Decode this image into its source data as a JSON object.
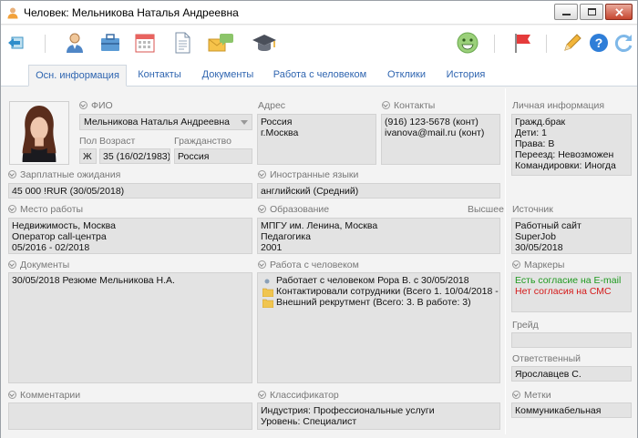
{
  "window": {
    "title": "Человек: Мельникова Наталья Андреевна"
  },
  "tabs": [
    {
      "label": "Осн. информация"
    },
    {
      "label": "Контакты"
    },
    {
      "label": "Документы"
    },
    {
      "label": "Работа с человеком"
    },
    {
      "label": "Отклики"
    },
    {
      "label": "История"
    }
  ],
  "toolbar": {
    "icons": [
      "back-icon",
      "person-icon",
      "briefcase-icon",
      "calendar-icon",
      "document-icon",
      "mail-chat-icon",
      "graduation-cap-icon",
      "smiley-icon",
      "flag-icon",
      "pencil-icon",
      "help-icon",
      "refresh-icon"
    ],
    "colors": {
      "smiley": "#9bd07a",
      "flag": "#e53b3b",
      "help": "#2f7ed8",
      "refresh": "#7fb8e8"
    }
  },
  "person": {
    "fio_label": "ФИО",
    "fio_value": "Мельникова Наталья Андреевна",
    "pol_label": "Пол",
    "pol_value": "Ж",
    "age_label": "Возраст",
    "age_value": "35 (16/02/1983)",
    "citizenship_label": "Гражданство",
    "citizenship_value": "Россия"
  },
  "address": {
    "label": "Адрес",
    "lines": [
      "Россия",
      "г.Москва"
    ]
  },
  "contacts": {
    "label": "Контакты",
    "lines": [
      "(916) 123-5678 (конт)",
      "ivanova@mail.ru (конт)"
    ]
  },
  "personal_info": {
    "label": "Личная информация",
    "lines": [
      "Гражд.брак",
      "Дети: 1",
      "Права: В",
      "Переезд: Невозможен",
      "Командировки: Иногда"
    ]
  },
  "salary": {
    "label": "Зарплатные ожидания",
    "value": "45 000 !RUR  (30/05/2018)"
  },
  "languages": {
    "label": "Иностранные языки",
    "value": "английский (Средний)"
  },
  "workplace": {
    "label": "Место работы",
    "lines": [
      "Недвижимость, Москва",
      "Оператор call-центра",
      "05/2016 - 02/2018"
    ]
  },
  "education": {
    "label": "Образование",
    "level": "Высшее",
    "lines": [
      "МПГУ им. Ленина, Москва",
      "Педагогика",
      "2001"
    ]
  },
  "source": {
    "label": "Источник",
    "lines": [
      "Работный сайт",
      "SuperJob",
      "30/05/2018"
    ]
  },
  "documents": {
    "label": "Документы",
    "value": "30/05/2018  Резюме Мельникова Н.А."
  },
  "work_with_person": {
    "label": "Работа с человеком",
    "items": [
      {
        "icon": "dot-icon",
        "text": "Работает с человеком Рора В. с 30/05/2018"
      },
      {
        "icon": "folder-icon",
        "text": "Контактировали сотрудники (Всего 1. 10/04/2018 -"
      },
      {
        "icon": "folder-icon",
        "text": "Внешний рекрутмент (Всего: 3. В работе: 3)"
      }
    ]
  },
  "markers": {
    "label": "Маркеры",
    "consent_email": "Есть согласие на E-mail",
    "consent_sms": "Нет согласия на СМС",
    "color_yes": "#1f9a1f",
    "color_no": "#d51a1a"
  },
  "grade": {
    "label": "Грейд",
    "value": ""
  },
  "responsible": {
    "label": "Ответственный",
    "value": "Ярославцев С."
  },
  "comments": {
    "label": "Комментарии",
    "value": ""
  },
  "classifier": {
    "label": "Классификатор",
    "lines": [
      "Индустрия: Профессиональные услуги",
      "Уровень: Специалист"
    ]
  },
  "tags": {
    "label": "Метки",
    "value": "Коммуникабельная"
  }
}
